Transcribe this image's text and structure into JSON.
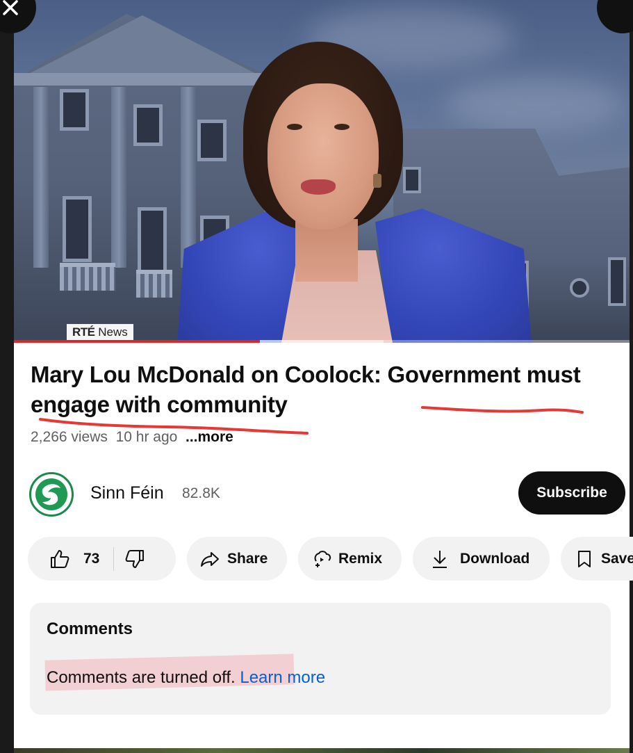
{
  "video": {
    "watermark_brand": "RTÉ",
    "watermark_label": "News",
    "progress": 0.4,
    "buffered": 0.6
  },
  "title": "Mary Lou McDonald on Coolock: Government must engage with community",
  "meta": {
    "views": "2,266 views",
    "age": "10 hr ago",
    "more": "...more"
  },
  "channel": {
    "name": "Sinn Féin",
    "subscribers": "82.8K",
    "subscribe_label": "Subscribe",
    "avatar_text": "SF"
  },
  "actions": {
    "like_count": "73",
    "share": "Share",
    "remix": "Remix",
    "download": "Download",
    "save": "Save"
  },
  "comments": {
    "heading": "Comments",
    "message": "Comments are turned off.",
    "link": "Learn more"
  },
  "colors": {
    "annotation_red": "#e53935",
    "subscribe_bg": "#0f0f0f",
    "link_blue": "#065fd4",
    "progress_red": "#d62a2a"
  }
}
